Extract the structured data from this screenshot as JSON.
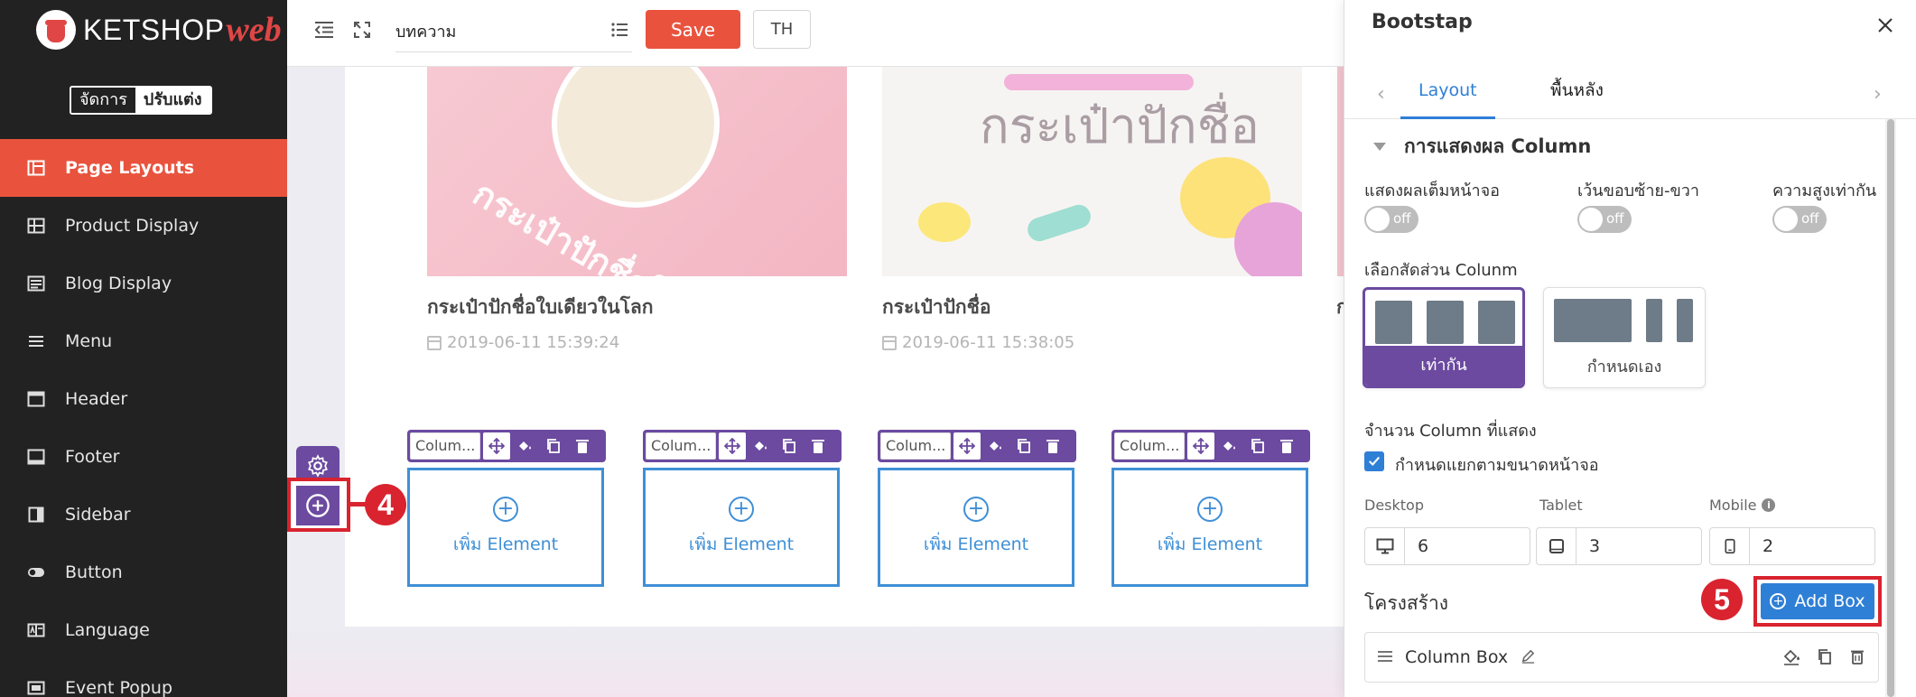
{
  "brand": {
    "name": "KETSHOP",
    "suffix": "web"
  },
  "mode_switch": {
    "manage": "จัดการ",
    "design": "ปรับแต่ง"
  },
  "sidebar": {
    "items": [
      {
        "label": "Page Layouts",
        "icon": "layout-icon",
        "active": true
      },
      {
        "label": "Product Display",
        "icon": "grid-icon"
      },
      {
        "label": "Blog Display",
        "icon": "blog-icon"
      },
      {
        "label": "Menu",
        "icon": "menu-icon"
      },
      {
        "label": "Header",
        "icon": "header-icon"
      },
      {
        "label": "Footer",
        "icon": "footer-icon"
      },
      {
        "label": "Sidebar",
        "icon": "sidebar-icon"
      },
      {
        "label": "Button",
        "icon": "toggle-icon"
      },
      {
        "label": "Language",
        "icon": "language-icon"
      },
      {
        "label": "Event Popup",
        "icon": "popup-icon"
      }
    ]
  },
  "toolbar": {
    "page_select": "บทความ",
    "save_label": "Save",
    "lang_label": "TH"
  },
  "canvas": {
    "blogs": [
      {
        "image_text": "กระเป๋าปักชื่อใบเดียวในโลก",
        "title": "กระเป๋าปักชื่อใบเดียวในโลก",
        "date": "2019-06-11 15:39:24"
      },
      {
        "image_text": "กระเป๋าปักชื่อ",
        "title": "กระเป๋าปักชื่อ",
        "date": "2019-06-11 15:38:05"
      }
    ],
    "third_title_edge": "ก",
    "columns": [
      {
        "label": "Colum...",
        "add_text": "เพิ่ม Element"
      },
      {
        "label": "Colum...",
        "add_text": "เพิ่ม Element"
      },
      {
        "label": "Colum...",
        "add_text": "เพิ่ม Element"
      },
      {
        "label": "Colum...",
        "add_text": "เพิ่ม Element"
      }
    ]
  },
  "markers": {
    "four": "4",
    "five": "5"
  },
  "panel": {
    "title": "Bootstap",
    "tabs": {
      "layout": "Layout",
      "background": "พื้นหลัง"
    },
    "section_title": "การแสดงผล Column",
    "options": [
      {
        "label": "แสดงผลเต็มหน้าจอ",
        "state": "off"
      },
      {
        "label": "เว้นขอบซ้าย-ขวา",
        "state": "off"
      },
      {
        "label": "ความสูงเท่ากัน",
        "state": "off"
      }
    ],
    "ratio_label": "เลือกสัดส่วน Colunm",
    "ratio_options": {
      "equal": "เท่ากัน",
      "custom": "กำหนดเอง"
    },
    "count_label": "จำนวน Column ที่แสดง",
    "responsive_label": "กำหนดแยกตามขนาดหน้าจอ",
    "devices": {
      "desktop": {
        "label": "Desktop",
        "value": "6"
      },
      "tablet": {
        "label": "Tablet",
        "value": "3"
      },
      "mobile": {
        "label": "Mobile",
        "value": "2"
      }
    },
    "structure_label": "โครงสร้าง",
    "add_box_label": "Add Box",
    "column_box_label": "Column Box"
  },
  "colors": {
    "accent_red": "#e9533e",
    "purple": "#6b4aa0",
    "blue": "#2e7fd6",
    "highlight": "#d9232f"
  }
}
